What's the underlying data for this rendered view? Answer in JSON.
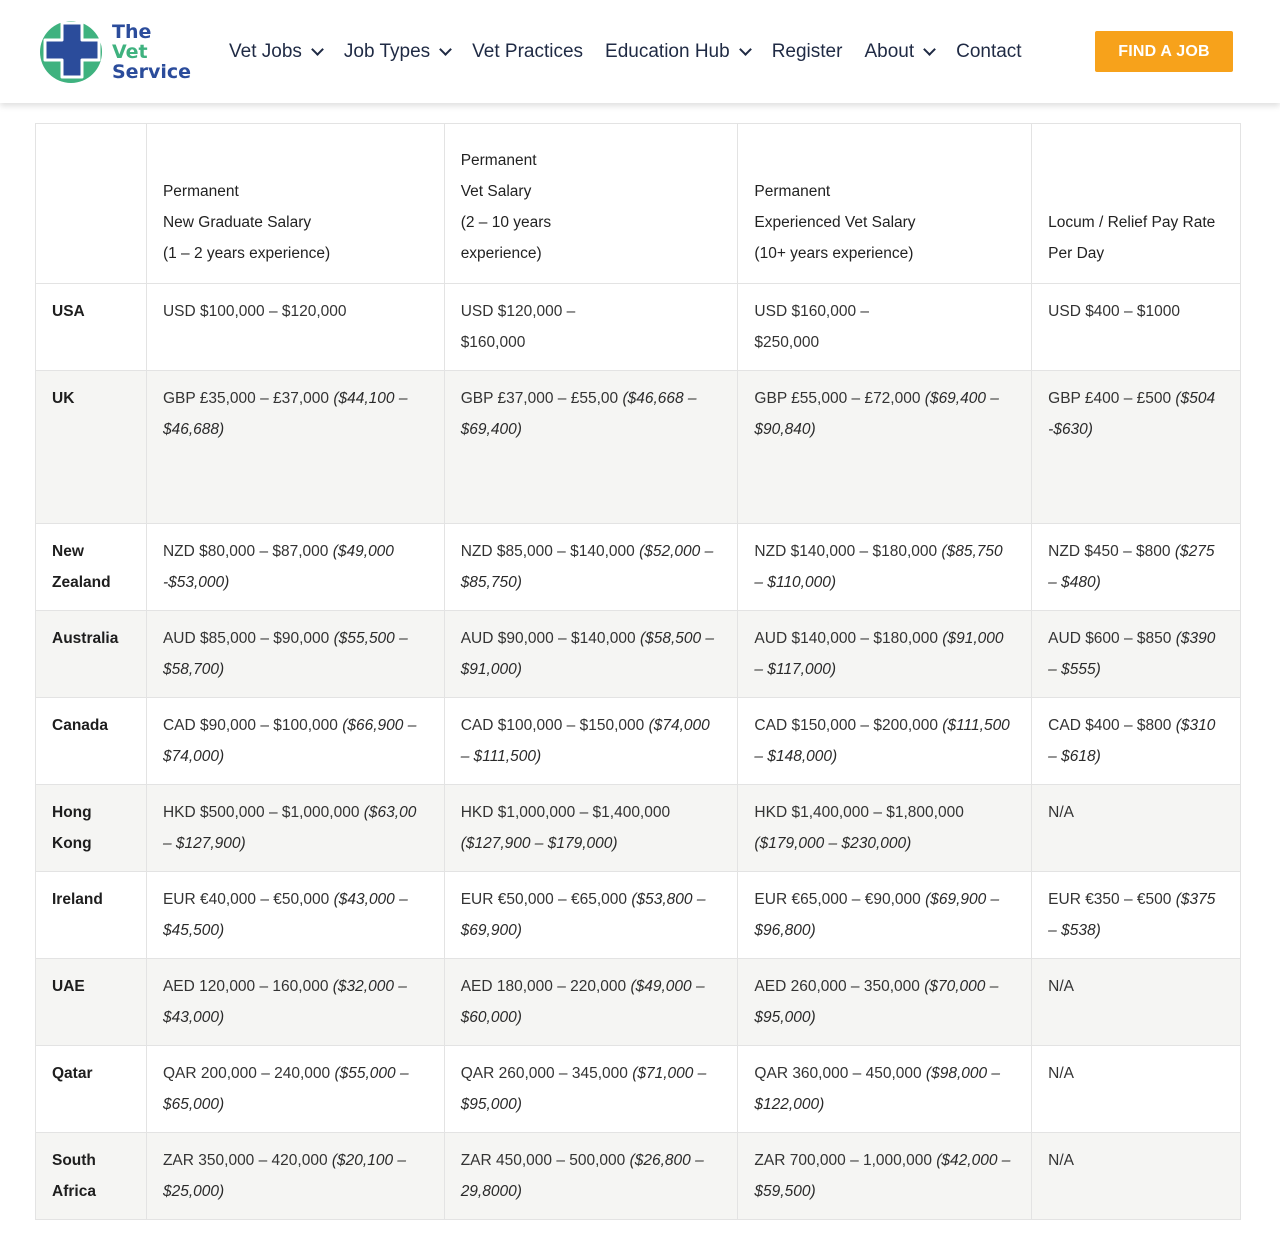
{
  "brand": {
    "line1": "The",
    "line2": "Vet",
    "line3": "Service",
    "colors": {
      "blue": "#2b4c9b",
      "green": "#3fb27f",
      "cta": "#f7a21b"
    }
  },
  "nav": {
    "items": [
      {
        "label": "Vet Jobs",
        "dropdown": true
      },
      {
        "label": "Job Types",
        "dropdown": true
      },
      {
        "label": "Vet Practices",
        "dropdown": false
      },
      {
        "label": "Education Hub",
        "dropdown": true
      },
      {
        "label": "Register",
        "dropdown": false
      },
      {
        "label": "About",
        "dropdown": true
      },
      {
        "label": "Contact",
        "dropdown": false
      }
    ],
    "cta_label": "FIND A JOB"
  },
  "table": {
    "headers": [
      [],
      [
        "Permanent",
        "New Graduate Salary",
        "(1 – 2 years experience)"
      ],
      [
        "Permanent",
        "Vet Salary",
        "(2 – 10 years",
        "experience)"
      ],
      [
        "Permanent",
        "Experienced Vet Salary",
        "(10+ years experience)"
      ],
      [
        "Locum / Relief Pay Rate",
        "Per Day"
      ]
    ],
    "rows": [
      {
        "country": [
          "USA"
        ],
        "cells": [
          {
            "text": [
              "USD $100,000 – $120,000"
            ],
            "conv": ""
          },
          {
            "text": [
              "USD $120,000 –",
              "$160,000"
            ],
            "conv": ""
          },
          {
            "text": [
              "USD $160,000 –",
              "$250,000"
            ],
            "conv": ""
          },
          {
            "text": [
              "USD $400 – $1000"
            ],
            "conv": ""
          }
        ]
      },
      {
        "country": [
          "UK"
        ],
        "cells": [
          {
            "text": [
              "GBP £35,000 – £37,000 "
            ],
            "conv": "($44,100 – $46,688)"
          },
          {
            "text": [
              "GBP £37,000 – £55,00 "
            ],
            "conv": "($46,668 – $69,400)"
          },
          {
            "text": [
              "GBP £55,000 – £72,000 "
            ],
            "conv": "($69,400 – $90,840)"
          },
          {
            "text": [
              "GBP £400 – £500 "
            ],
            "conv": "($504 -$630)"
          }
        ]
      },
      {
        "country": [
          "New",
          "Zealand"
        ],
        "cells": [
          {
            "text": [
              "NZD $80,000 – $87,000 "
            ],
            "conv": "($49,000 -$53,000)"
          },
          {
            "text": [
              "NZD $85,000 – $140,000 "
            ],
            "conv": "($52,000 – $85,750)"
          },
          {
            "text": [
              "NZD $140,000 – $180,000 "
            ],
            "conv": "($85,750 – $110,000)"
          },
          {
            "text": [
              "NZD $450 – $800 "
            ],
            "conv": "($275 – $480)"
          }
        ]
      },
      {
        "country": [
          "Australia"
        ],
        "cells": [
          {
            "text": [
              "AUD $85,000 – $90,000 "
            ],
            "conv": "($55,500 – $58,700)"
          },
          {
            "text": [
              "AUD $90,000 – $140,000 "
            ],
            "conv": "($58,500 – $91,000)"
          },
          {
            "text": [
              "AUD $140,000 – $180,000 "
            ],
            "conv": "($91,000 – $117,000)"
          },
          {
            "text": [
              "AUD $600 – $850 "
            ],
            "conv": "($390 – $555)"
          }
        ]
      },
      {
        "country": [
          "Canada"
        ],
        "cells": [
          {
            "text": [
              "CAD $90,000 – $100,000 "
            ],
            "conv": "($66,900 – $74,000)"
          },
          {
            "text": [
              "CAD $100,000 – $150,000 "
            ],
            "conv": "($74,000 – $111,500)"
          },
          {
            "text": [
              "CAD $150,000 – $200,000 "
            ],
            "conv": "($111,500 – $148,000)"
          },
          {
            "text": [
              "CAD $400 – $800  "
            ],
            "conv": "($310 – $618)"
          }
        ]
      },
      {
        "country": [
          "Hong Kong"
        ],
        "cells": [
          {
            "text": [
              "HKD $500,000 – $1,000,000 "
            ],
            "conv": "($63,00 – $127,900)"
          },
          {
            "text": [
              "HKD $1,000,000 – $1,400,000 "
            ],
            "conv": "($127,900 – $179,000)"
          },
          {
            "text": [
              "HKD $1,400,000 – $1,800,000 "
            ],
            "conv": "($179,000 – $230,000)"
          },
          {
            "text": [
              "N/A"
            ],
            "conv": ""
          }
        ]
      },
      {
        "country": [
          "Ireland"
        ],
        "cells": [
          {
            "text": [
              "EUR €40,000 – €50,000 "
            ],
            "conv": "($43,000 – $45,500)"
          },
          {
            "text": [
              "EUR €50,000 – €65,000 "
            ],
            "conv": "($53,800 – $69,900)"
          },
          {
            "text": [
              "EUR €65,000 – €90,000 "
            ],
            "conv": "($69,900 – $96,800)"
          },
          {
            "text": [
              "EUR €350 – €500 "
            ],
            "conv": "($375 – $538)"
          }
        ]
      },
      {
        "country": [
          "UAE"
        ],
        "cells": [
          {
            "text": [
              "AED 120,000 – 160,000 "
            ],
            "conv": "($32,000 – $43,000)"
          },
          {
            "text": [
              "AED 180,000 – 220,000 "
            ],
            "conv": "($49,000 – $60,000)"
          },
          {
            "text": [
              "AED 260,000 – 350,000 "
            ],
            "conv": "($70,000 – $95,000)"
          },
          {
            "text": [
              "N/A"
            ],
            "conv": ""
          }
        ]
      },
      {
        "country": [
          "Qatar"
        ],
        "cells": [
          {
            "text": [
              "QAR 200,000 – 240,000 "
            ],
            "conv": "($55,000 – $65,000)"
          },
          {
            "text": [
              "QAR 260,000 – 345,000 "
            ],
            "conv": "($71,000 – $95,000)"
          },
          {
            "text": [
              "QAR 360,000 – 450,000 "
            ],
            "conv": "($98,000 – $122,000)"
          },
          {
            "text": [
              "N/A"
            ],
            "conv": ""
          }
        ]
      },
      {
        "country": [
          "South",
          "Africa"
        ],
        "cells": [
          {
            "text": [
              "ZAR 350,000 – 420,000 "
            ],
            "conv": "($20,100 – $25,000)"
          },
          {
            "text": [
              "ZAR 450,000 – 500,000 "
            ],
            "conv": "($26,800 – 29,8000)"
          },
          {
            "text": [
              "ZAR 700,000 – 1,000,000 "
            ],
            "conv": "($42,000 – $59,500)"
          },
          {
            "text": [
              "N/A"
            ],
            "conv": ""
          }
        ]
      }
    ]
  }
}
